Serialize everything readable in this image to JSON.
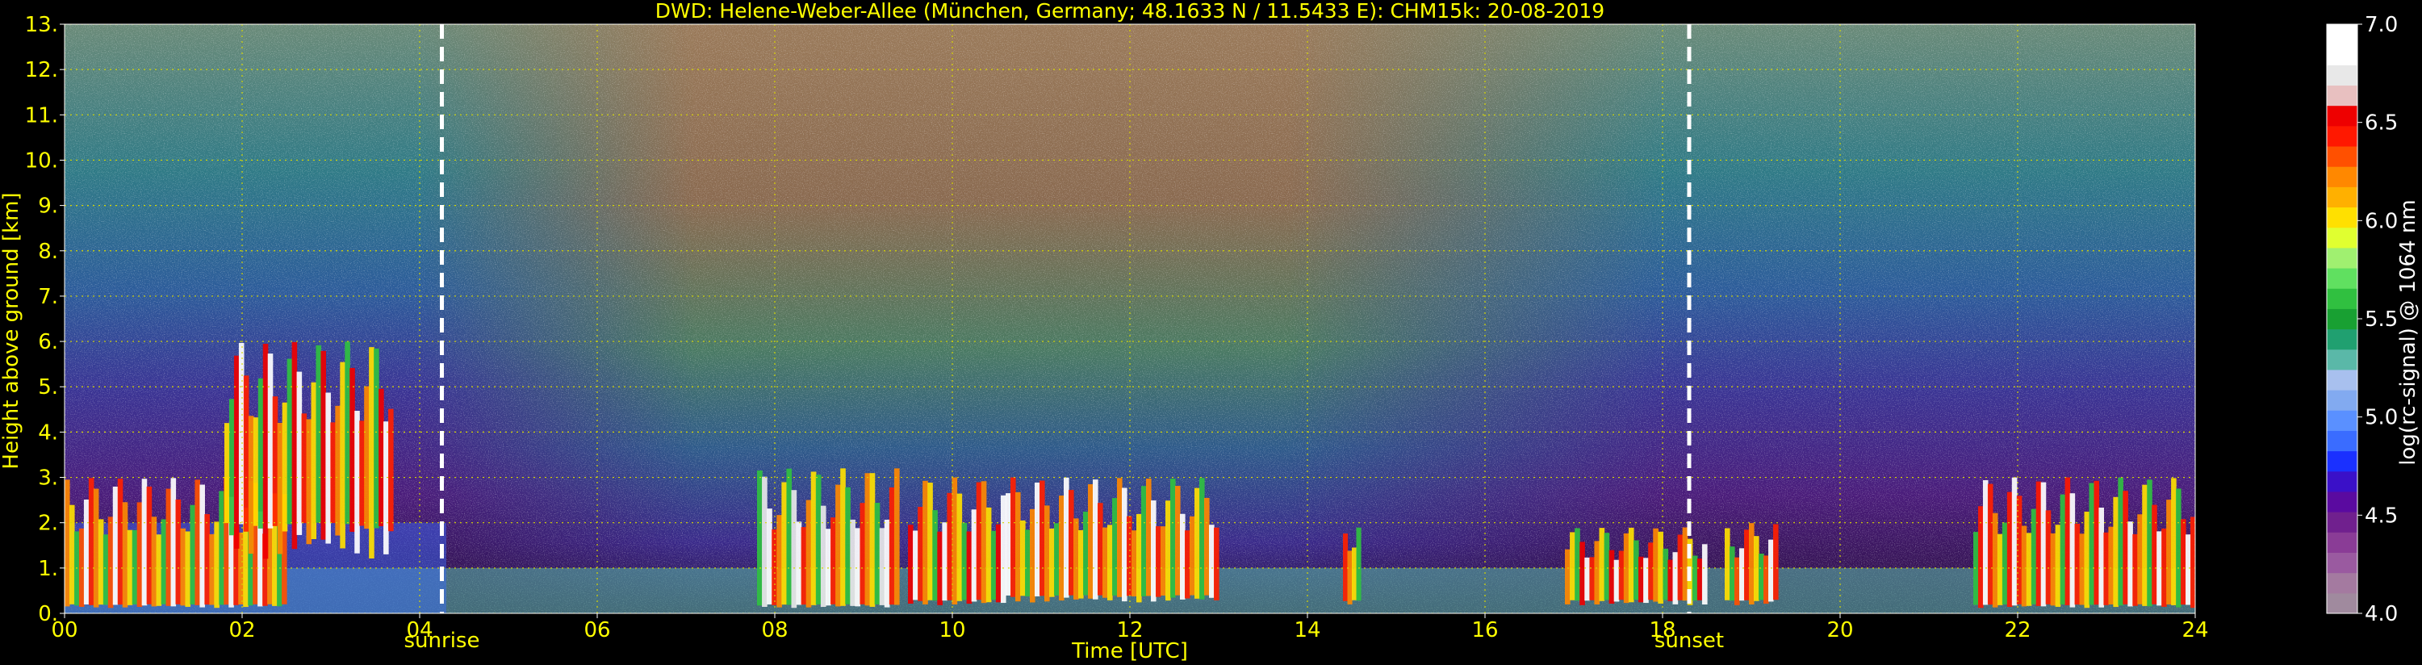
{
  "chart_data": {
    "type": "heatmap",
    "title": "DWD: Helene-Weber-Allee (München, Germany; 48.1633 N / 11.5433 E):    CHM15k: 20-08-2019",
    "xlabel": "Time [UTC]",
    "ylabel": "Height above ground [km]",
    "xlim": [
      0,
      24
    ],
    "ylim": [
      0,
      13
    ],
    "x_ticks": [
      {
        "value": 0,
        "label": "00"
      },
      {
        "value": 2,
        "label": "02"
      },
      {
        "value": 4,
        "label": "04"
      },
      {
        "value": 6,
        "label": "06"
      },
      {
        "value": 8,
        "label": "08"
      },
      {
        "value": 10,
        "label": "10"
      },
      {
        "value": 12,
        "label": "12"
      },
      {
        "value": 14,
        "label": "14"
      },
      {
        "value": 16,
        "label": "16"
      },
      {
        "value": 18,
        "label": "18"
      },
      {
        "value": 20,
        "label": "20"
      },
      {
        "value": 22,
        "label": "22"
      },
      {
        "value": 24,
        "label": "24"
      }
    ],
    "y_ticks": [
      {
        "value": 0,
        "label": "0."
      },
      {
        "value": 1,
        "label": "1."
      },
      {
        "value": 2,
        "label": "2."
      },
      {
        "value": 3,
        "label": "3."
      },
      {
        "value": 4,
        "label": "4."
      },
      {
        "value": 5,
        "label": "5."
      },
      {
        "value": 6,
        "label": "6."
      },
      {
        "value": 7,
        "label": "7."
      },
      {
        "value": 8,
        "label": "8."
      },
      {
        "value": 9,
        "label": "9."
      },
      {
        "value": 10,
        "label": "10."
      },
      {
        "value": 11,
        "label": "11."
      },
      {
        "value": 12,
        "label": "12."
      },
      {
        "value": 13,
        "label": "13."
      }
    ],
    "markers": [
      {
        "x": 4.25,
        "label": "sunrise"
      },
      {
        "x": 18.3,
        "label": "sunset"
      }
    ],
    "grid": true,
    "colorbar": {
      "label": "log(rc-signal) @ 1064 nm",
      "range": [
        4.0,
        7.0
      ],
      "ticks": [
        {
          "value": 4.0,
          "label": "4.0"
        },
        {
          "value": 4.5,
          "label": "4.5"
        },
        {
          "value": 5.0,
          "label": "5.0"
        },
        {
          "value": 5.5,
          "label": "5.5"
        },
        {
          "value": 6.0,
          "label": "6.0"
        },
        {
          "value": 6.5,
          "label": "6.5"
        },
        {
          "value": 7.0,
          "label": "7.0"
        }
      ],
      "colors": [
        "#a08a9e",
        "#a47aa0",
        "#9a5aa0",
        "#8a3c96",
        "#70208e",
        "#5a0aa0",
        "#3a10c8",
        "#1a30ff",
        "#3a6cff",
        "#5a90ff",
        "#82aaf0",
        "#a8c0ee",
        "#5ab8a8",
        "#20a070",
        "#18a032",
        "#30c040",
        "#60e060",
        "#a0f070",
        "#e0ff30",
        "#ffe000",
        "#ffb000",
        "#ff8800",
        "#ff5000",
        "#ff1800",
        "#ee0000",
        "#e8c0c0",
        "#e8e8e8",
        "#ffffff",
        "#ffffff"
      ]
    },
    "features": [
      {
        "kind": "boundary_layer",
        "x_range": [
          0,
          24
        ],
        "top": 1.0,
        "level": 5.3
      },
      {
        "kind": "residual_layer",
        "x_range": [
          0,
          4.3
        ],
        "top": 2.0,
        "level": 4.9
      },
      {
        "kind": "cloud_layer",
        "x_range": [
          0,
          2.5
        ],
        "base": 0.2,
        "top": 3.0,
        "level": 6.4
      },
      {
        "kind": "cloud_layer",
        "x_range": [
          1.8,
          3.7
        ],
        "base": 2.0,
        "top": 6.0,
        "level": 6.6
      },
      {
        "kind": "cloud_layer",
        "x_range": [
          7.8,
          9.4
        ],
        "base": 0.2,
        "top": 3.2,
        "level": 6.8
      },
      {
        "kind": "cloud_layer",
        "x_range": [
          9.5,
          10.6
        ],
        "base": 0.3,
        "top": 3.0,
        "level": 6.6
      },
      {
        "kind": "cloud_layer",
        "x_range": [
          10.6,
          13.0
        ],
        "base": 0.4,
        "top": 3.0,
        "level": 6.3
      },
      {
        "kind": "cloud_layer",
        "x_range": [
          14.4,
          14.6
        ],
        "base": 0.3,
        "top": 2.2,
        "level": 6.5
      },
      {
        "kind": "cloud_layer",
        "x_range": [
          16.9,
          18.5
        ],
        "base": 0.3,
        "top": 1.9,
        "level": 6.6
      },
      {
        "kind": "cloud_layer",
        "x_range": [
          18.7,
          19.3
        ],
        "base": 0.3,
        "top": 2.0,
        "level": 6.4
      },
      {
        "kind": "cloud_layer",
        "x_range": [
          21.5,
          24.0
        ],
        "base": 0.2,
        "top": 3.0,
        "level": 6.5
      }
    ]
  }
}
